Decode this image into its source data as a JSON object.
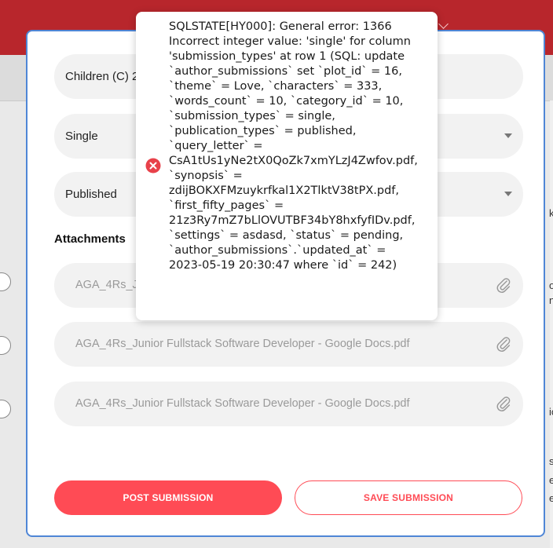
{
  "form": {
    "category_value": "Children (C) 2",
    "submission_type_value": "Single",
    "publication_type_value": "Published",
    "attachments_title": "Attachments",
    "attachments": [
      "AGA_4Rs_J",
      "AGA_4Rs_Junior Fullstack Software Developer - Google Docs.pdf",
      "AGA_4Rs_Junior Fullstack Software Developer - Google Docs.pdf"
    ],
    "post_label": "POST SUBMISSION",
    "save_label": "SAVE SUBMISSION"
  },
  "error_toast": {
    "lines": [
      "SQLSTATE[HY000]: General error: 1366",
      "Incorrect integer value: 'single' for column",
      "'submission_types' at row 1 (SQL: update",
      "`author_submissions` set `plot_id` = 16,",
      "`theme` = Love, `characters` = 333,",
      "`words_count` = 10, `category_id` = 10,",
      "`submission_types` = single,",
      "`publication_types` = published,",
      "`query_letter` =",
      "CsA1tUs1yNe2tX0QoZk7xmYLzJ4Zwfov.pdf,",
      "`synopsis` =",
      "zdijBOKXFMzuykrfkal1X2TlktV38tPX.pdf,",
      "`first_fifty_pages` =",
      "21z3Ry7mZ7bLlOVUTBF34bY8hxfyfIDv.pdf,",
      "`settings` = asdasd, `status` = pending,",
      "`author_submissions`.`updated_at` =",
      "2023-05-19 20:30:47 where `id` = 242)"
    ]
  },
  "background": {
    "right_letters": [
      "k",
      "o",
      "n",
      "ic",
      "s",
      "e",
      "e"
    ]
  },
  "colors": {
    "accent": "#ff4b55",
    "modal_border": "#4f86d6",
    "header_bg": "#b8262c",
    "error_icon": "#e8414a"
  },
  "icons": {
    "field_caret": "chevron-down-icon",
    "attachment": "paperclip-icon",
    "error": "error-circle-icon"
  }
}
